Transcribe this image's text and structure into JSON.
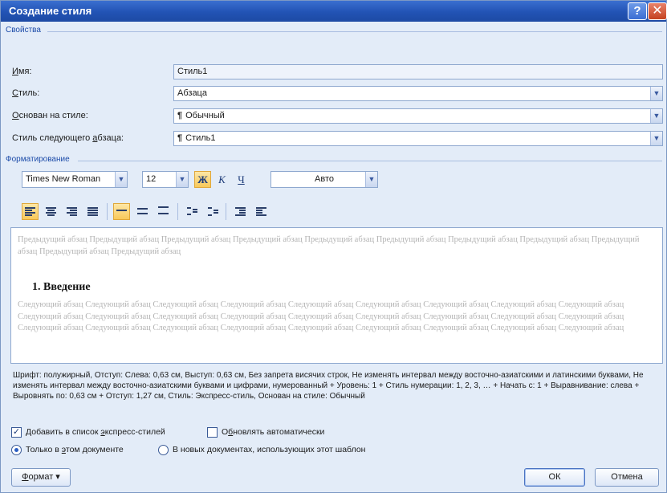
{
  "window": {
    "title": "Создание стиля",
    "help_label": "?",
    "close_label": "✕"
  },
  "properties": {
    "header": "Свойства",
    "name": {
      "label_accel": "И",
      "label_rest": "мя:",
      "value": "Стиль1"
    },
    "style_type": {
      "label_accel": "С",
      "label_rest": "тиль:",
      "value": "Абзаца"
    },
    "based_on": {
      "label_accel": "О",
      "label_rest": "снован на стиле:",
      "mark": "¶",
      "value": "Обычный"
    },
    "next_style": {
      "label_pre": "Стиль следующего ",
      "label_accel": "а",
      "label_rest": "бзаца:",
      "mark": "¶",
      "value": "Стиль1"
    }
  },
  "formatting": {
    "header": "Форматирование",
    "font_name": "Times New Roman",
    "font_size": "12",
    "bold_label": "Ж",
    "italic_label": "К",
    "underline_label": "Ч",
    "color_value": "Авто",
    "icons": {
      "align_left": "align-left-icon",
      "align_center": "align-center-icon",
      "align_right": "align-right-icon",
      "align_justify": "align-justify-icon",
      "line_single": "line-spacing-single-icon",
      "line_onehalf": "line-spacing-onehalf-icon",
      "line_double": "line-spacing-double-icon",
      "space_before": "space-before-icon",
      "space_after": "space-after-icon",
      "indent_decrease": "indent-decrease-icon",
      "indent_increase": "indent-increase-icon"
    }
  },
  "preview": {
    "prev_text": "Предыдущий абзац Предыдущий абзац Предыдущий абзац Предыдущий абзац Предыдущий абзац Предыдущий абзац Предыдущий абзац Предыдущий абзац Предыдущий абзац Предыдущий абзац Предыдущий абзац",
    "heading": "1.  Введение",
    "next_text": "Следующий абзац Следующий абзац Следующий абзац Следующий абзац Следующий абзац Следующий абзац Следующий абзац Следующий абзац Следующий абзац Следующий абзац Следующий абзац Следующий абзац Следующий абзац Следующий абзац Следующий абзац Следующий абзац Следующий абзац Следующий абзац Следующий абзац Следующий абзац Следующий абзац Следующий абзац Следующий абзац Следующий абзац Следующий абзац Следующий абзац Следующий абзац"
  },
  "description": "Шрифт: полужирный, Отступ: Слева: 0,63 см, Выступ: 0,63 см, Без запрета висячих строк, Не изменять интервал между восточно-азиатскими и латинскими буквами, Не изменять интервал между восточно-азиатскими буквами и цифрами, нумерованный + Уровень: 1 + Стиль нумерации: 1, 2, 3, … + Начать с: 1 + Выравнивание: слева + Выровнять по: 0,63 см + Отступ: 1,27 см, Стиль: Экспресс-стиль, Основан на стиле: Обычный",
  "options": {
    "add_quick_pre": "Добавить в список ",
    "add_quick_accel": "э",
    "add_quick_rest": "кспресс-стилей",
    "add_quick_checked": "✓",
    "auto_update_pre": "О",
    "auto_update_accel": "б",
    "auto_update_rest": "новлять автоматически",
    "only_doc_pre": "Только в ",
    "only_doc_accel": "э",
    "only_doc_rest": "том документе",
    "new_docs": "В новых документах, использующих этот шаблон"
  },
  "buttons": {
    "format_accel": "Ф",
    "format_rest": "ормат ▾",
    "ok": "ОК",
    "cancel": "Отмена"
  }
}
